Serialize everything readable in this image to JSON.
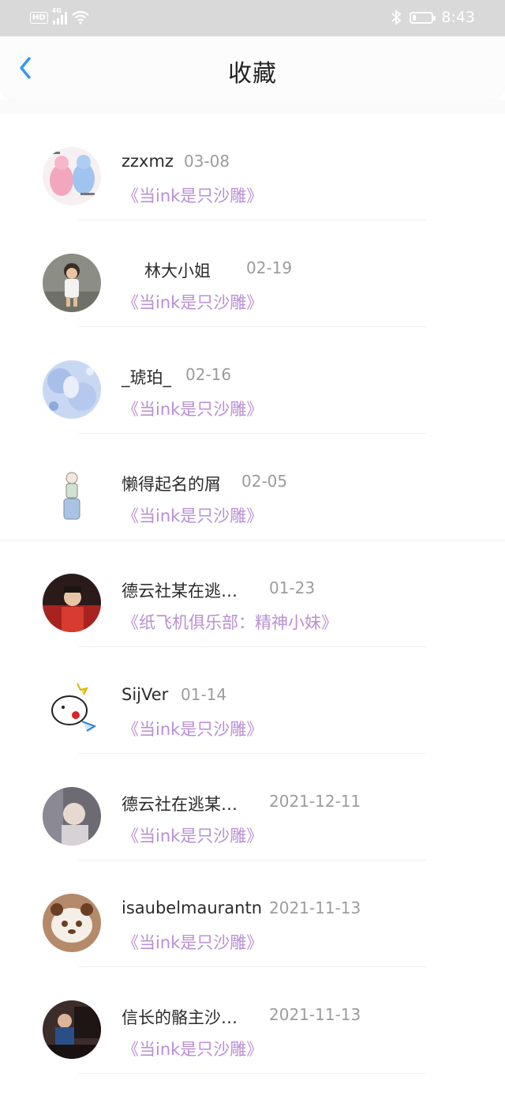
{
  "status_bar": {
    "hd": "HD",
    "network": "4G",
    "bluetooth_icon": "bluetooth-icon",
    "battery_level": 0.2,
    "time": "8:43"
  },
  "header": {
    "title": "收藏",
    "back_icon": "chevron-left-icon"
  },
  "colors": {
    "accent": "#2f97f3",
    "link": "#b98fd6",
    "status_bar_bg": "#d9d9d9"
  },
  "items": [
    {
      "name": "zzxmz",
      "date": "03-08",
      "link": "《当ink是只沙雕》"
    },
    {
      "name": "林大小姐",
      "date": "02-19",
      "link": "《当ink是只沙雕》"
    },
    {
      "name": "_琥珀_",
      "date": "02-16",
      "link": "《当ink是只沙雕》"
    },
    {
      "name": "懒得起名的屑",
      "date": "02-05",
      "link": "《当ink是只沙雕》"
    },
    {
      "name": "德云社某在逃…",
      "date": "01-23",
      "link": "《纸飞机俱乐部：精神小妹》"
    },
    {
      "name": "SijVer",
      "date": "01-14",
      "link": "《当ink是只沙雕》"
    },
    {
      "name": "德云社在逃某…",
      "date": "2021-12-11",
      "link": "《当ink是只沙雕》"
    },
    {
      "name": "isaubelmaurantn",
      "date": "2021-11-13",
      "link": "《当ink是只沙雕》"
    },
    {
      "name": "信长的骼主沙…",
      "date": "2021-11-13",
      "link": "《当ink是只沙雕》"
    }
  ]
}
